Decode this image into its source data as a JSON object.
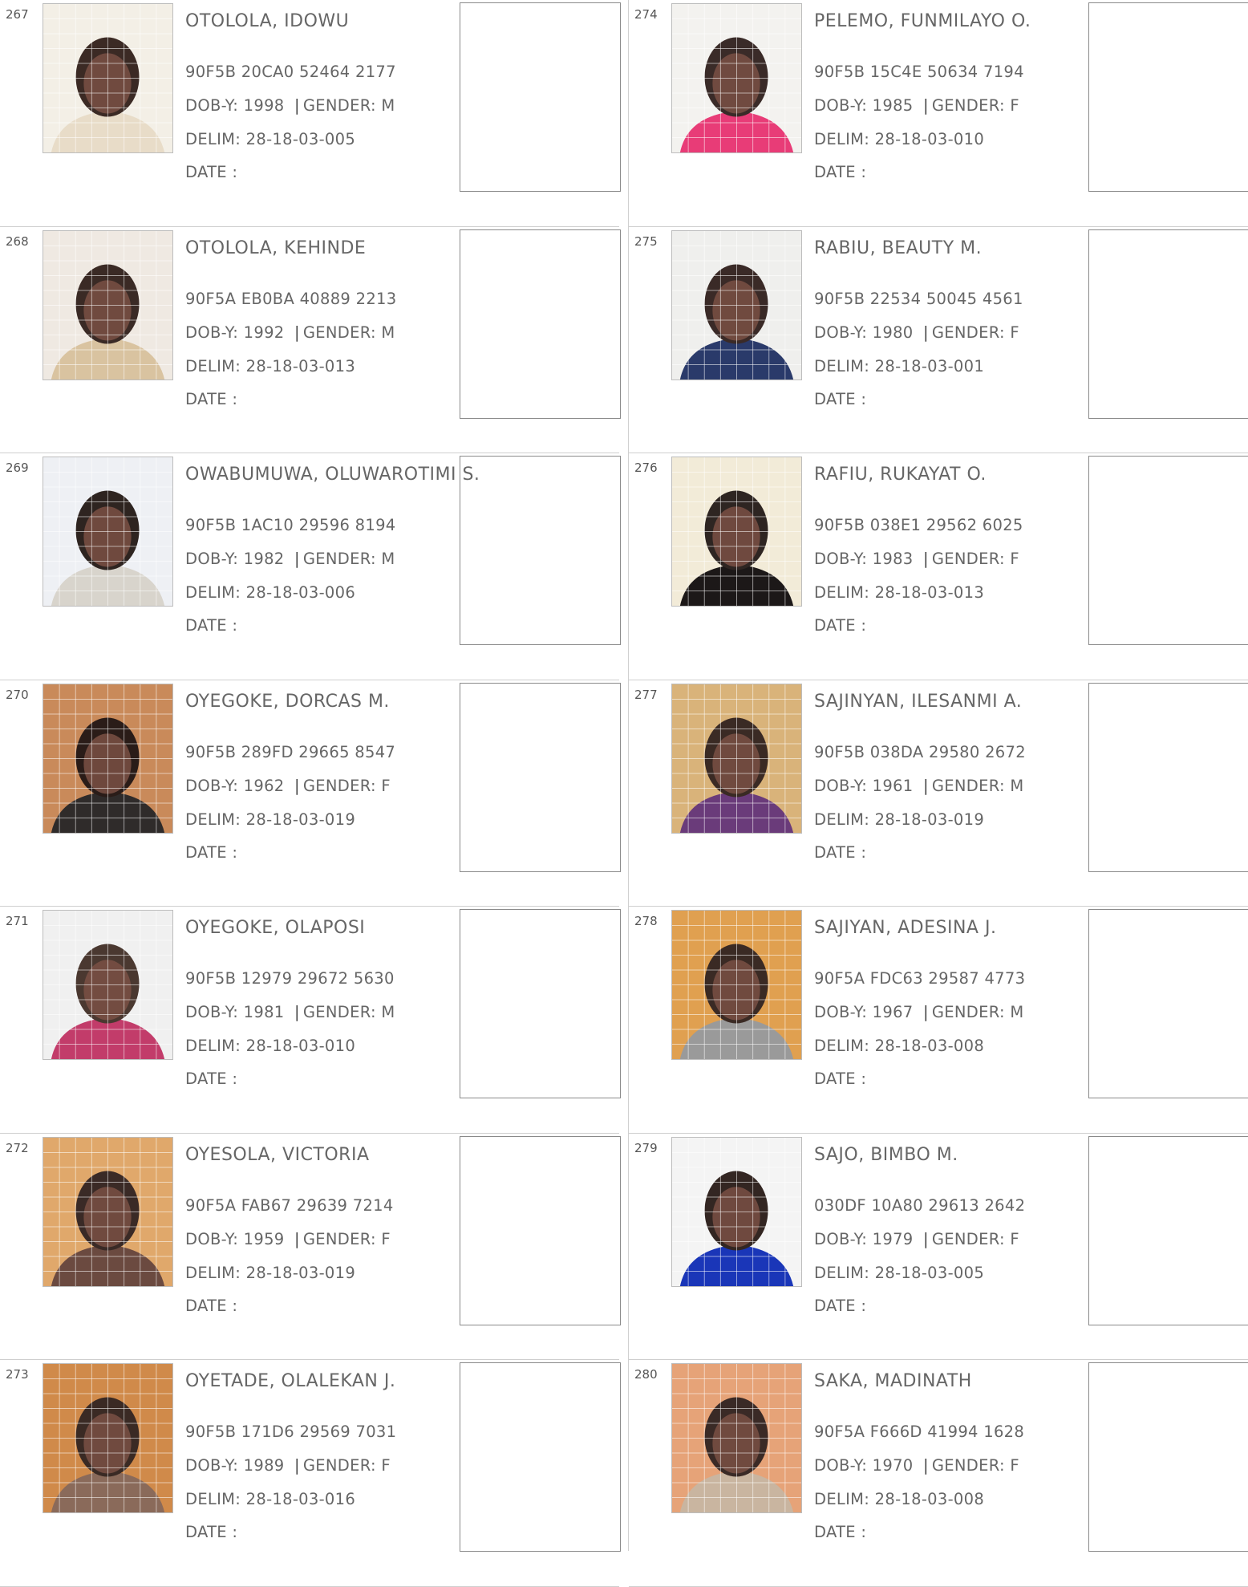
{
  "labels": {
    "dob_prefix": "DOB-Y:",
    "gender_sep": "|",
    "gender_prefix": "GENDER:",
    "delim_prefix": "DELIM:",
    "date_label": "DATE  :"
  },
  "left_column": [
    {
      "num": "267",
      "name": "OTOLOLA, IDOWU",
      "id": "90F5B 20CA0 52464 2177",
      "dob": "1998",
      "gender": "M",
      "delim": "28-18-03-005"
    },
    {
      "num": "268",
      "name": "OTOLOLA, KEHINDE",
      "id": "90F5A EB0BA 40889 2213",
      "dob": "1992",
      "gender": "M",
      "delim": "28-18-03-013"
    },
    {
      "num": "269",
      "name": "OWABUMUWA, OLUWAROTIMI S.",
      "id": "90F5B 1AC10 29596 8194",
      "dob": "1982",
      "gender": "M",
      "delim": "28-18-03-006"
    },
    {
      "num": "270",
      "name": "OYEGOKE, DORCAS M.",
      "id": "90F5B 289FD 29665 8547",
      "dob": "1962",
      "gender": "F",
      "delim": "28-18-03-019"
    },
    {
      "num": "271",
      "name": "OYEGOKE, OLAPOSI",
      "id": "90F5B 12979 29672 5630",
      "dob": "1981",
      "gender": "M",
      "delim": "28-18-03-010"
    },
    {
      "num": "272",
      "name": "OYESOLA, VICTORIA",
      "id": "90F5A FAB67 29639 7214",
      "dob": "1959",
      "gender": "F",
      "delim": "28-18-03-019"
    },
    {
      "num": "273",
      "name": "OYETADE, OLALEKAN J.",
      "id": "90F5B 171D6 29569 7031",
      "dob": "1989",
      "gender": "F",
      "delim": "28-18-03-016"
    }
  ],
  "right_column": [
    {
      "num": "274",
      "name": "PELEMO, FUNMILAYO O.",
      "id": "90F5B 15C4E 50634 7194",
      "dob": "1985",
      "gender": "F",
      "delim": "28-18-03-010"
    },
    {
      "num": "275",
      "name": "RABIU, BEAUTY M.",
      "id": "90F5B 22534 50045 4561",
      "dob": "1980",
      "gender": "F",
      "delim": "28-18-03-001"
    },
    {
      "num": "276",
      "name": "RAFIU, RUKAYAT O.",
      "id": "90F5B 038E1 29562 6025",
      "dob": "1983",
      "gender": "F",
      "delim": "28-18-03-013"
    },
    {
      "num": "277",
      "name": "SAJINYAN, ILESANMI A.",
      "id": "90F5B 038DA 29580 2672",
      "dob": "1961",
      "gender": "M",
      "delim": "28-18-03-019"
    },
    {
      "num": "278",
      "name": "SAJIYAN, ADESINA J.",
      "id": "90F5A FDC63 29587 4773",
      "dob": "1967",
      "gender": "M",
      "delim": "28-18-03-008"
    },
    {
      "num": "279",
      "name": "SAJO, BIMBO M.",
      "id": "030DF 10A80 29613 2642",
      "dob": "1979",
      "gender": "F",
      "delim": "28-18-03-005"
    },
    {
      "num": "280",
      "name": "SAKA, MADINATH",
      "id": "90F5A F666D 41994 1628",
      "dob": "1970",
      "gender": "F",
      "delim": "28-18-03-008"
    }
  ]
}
